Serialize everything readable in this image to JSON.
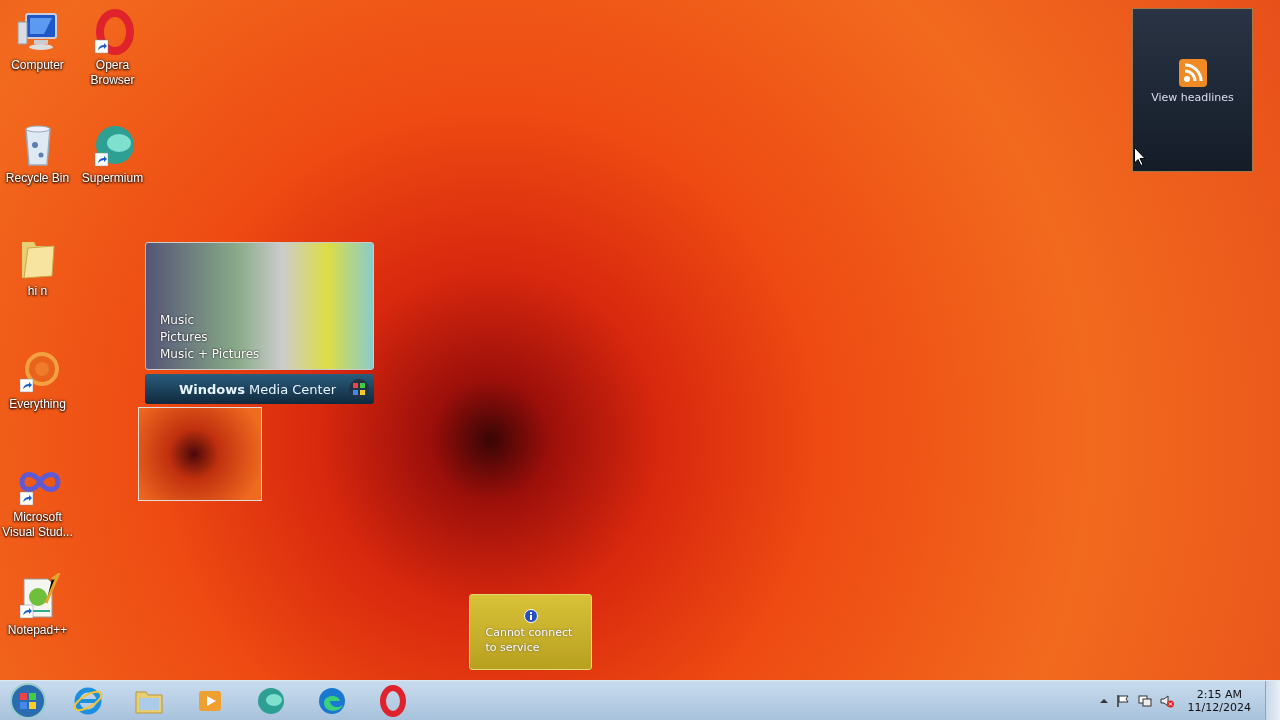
{
  "desktop_icons": [
    {
      "label": "Computer",
      "kind": "computer",
      "shortcut": false
    },
    {
      "label": "Recycle Bin",
      "kind": "recycle-bin",
      "shortcut": false
    },
    {
      "label": "hi n",
      "kind": "folder",
      "shortcut": false
    },
    {
      "label": "Everything",
      "kind": "everything",
      "shortcut": true
    },
    {
      "label": "Microsoft Visual Stud...",
      "kind": "visual-studio",
      "shortcut": true
    },
    {
      "label": "Notepad++",
      "kind": "notepad",
      "shortcut": true
    },
    {
      "label": "Opera Browser",
      "kind": "opera",
      "shortcut": true
    },
    {
      "label": "Supermium",
      "kind": "supermium",
      "shortcut": true
    }
  ],
  "media_center_gadget": {
    "items": [
      "Music",
      "Pictures",
      "Music + Pictures"
    ],
    "brand": "Windows",
    "product": "Media Center"
  },
  "feed_gadget": {
    "label": "View headlines"
  },
  "currency_gadget": {
    "message": "Cannot connect to service"
  },
  "taskbar": {
    "pinned": [
      {
        "kind": "ie"
      },
      {
        "kind": "explorer"
      },
      {
        "kind": "media-player"
      },
      {
        "kind": "supermium"
      },
      {
        "kind": "edge"
      },
      {
        "kind": "opera"
      }
    ],
    "tray": {
      "muted": true,
      "time": "2:15 AM",
      "date": "11/12/2024"
    }
  }
}
